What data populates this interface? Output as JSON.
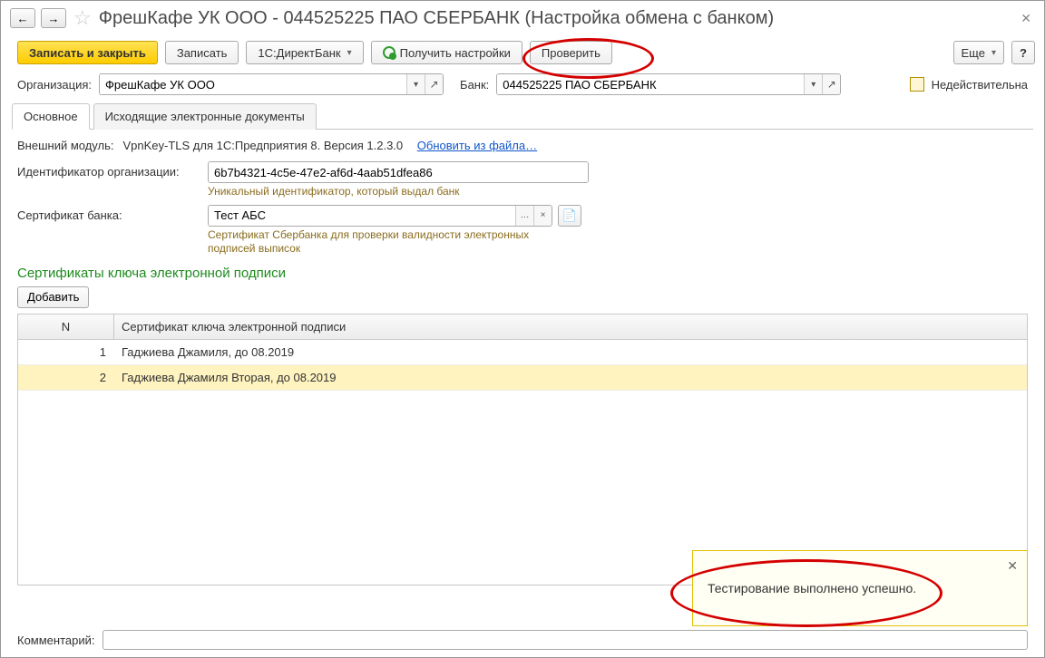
{
  "header": {
    "title": "ФрешКафе УК ООО - 044525225 ПАО СБЕРБАНК (Настройка обмена с банком)"
  },
  "toolbar": {
    "save_close": "Записать и закрыть",
    "save": "Записать",
    "directbank": "1С:ДиректБанк",
    "get_settings": "Получить настройки",
    "check": "Проверить",
    "more": "Еще",
    "help": "?"
  },
  "form": {
    "org_label": "Организация:",
    "org_value": "ФрешКафе УК ООО",
    "bank_label": "Банк:",
    "bank_value": "044525225 ПАО СБЕРБАНК",
    "invalid_label": "Недействительна"
  },
  "tabs": {
    "main": "Основное",
    "outgoing": "Исходящие электронные документы"
  },
  "main_tab": {
    "module_label": "Внешний модуль:",
    "module_value": "VpnKey-TLS для 1С:Предприятия 8. Версия 1.2.3.0",
    "module_link": "Обновить из файла…",
    "org_id_label": "Идентификатор организации:",
    "org_id_value": "6b7b4321-4c5e-47e2-af6d-4aab51dfea86",
    "org_id_hint": "Уникальный идентификатор, который выдал банк",
    "bank_cert_label": "Сертификат банка:",
    "bank_cert_value": "Тест АБС",
    "bank_cert_hint": "Сертификат Сбербанка для проверки валидности электронных подписей выписок",
    "section_title": "Сертификаты ключа электронной подписи",
    "add_btn": "Добавить",
    "table": {
      "col_n": "N",
      "col_title": "Сертификат ключа электронной подписи",
      "rows": [
        {
          "n": "1",
          "title": "Гаджиева Джамиля, до 08.2019"
        },
        {
          "n": "2",
          "title": "Гаджиева Джамиля Вторая, до 08.2019"
        }
      ]
    }
  },
  "comment_label": "Комментарий:",
  "comment_value": "",
  "toast": {
    "text": "Тестирование выполнено успешно."
  }
}
